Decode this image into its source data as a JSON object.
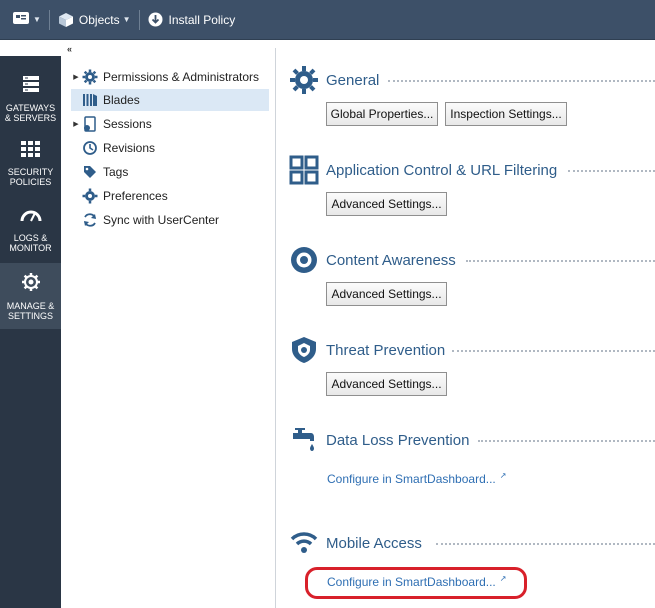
{
  "toolbar": {
    "objects_label": "Objects",
    "install_policy_label": "Install Policy"
  },
  "rail": {
    "items": [
      {
        "label": "GATEWAYS\n& SERVERS",
        "l1": "GATEWAYS",
        "l2": "& SERVERS"
      },
      {
        "label": "SECURITY POLICIES",
        "l1": "SECURITY",
        "l2": "POLICIES"
      },
      {
        "label": "LOGS & MONITOR",
        "l1": "LOGS &",
        "l2": "MONITOR"
      },
      {
        "label": "MANAGE & SETTINGS",
        "l1": "MANAGE &",
        "l2": "SETTINGS"
      }
    ]
  },
  "tree": {
    "items": [
      {
        "label": "Permissions & Administrators"
      },
      {
        "label": "Blades"
      },
      {
        "label": "Sessions"
      },
      {
        "label": "Revisions"
      },
      {
        "label": "Tags"
      },
      {
        "label": "Preferences"
      },
      {
        "label": "Sync with UserCenter"
      }
    ]
  },
  "sections": {
    "general": {
      "title": "General",
      "btn1": "Global Properties...",
      "btn2": "Inspection Settings..."
    },
    "appcontrol": {
      "title": "Application Control & URL Filtering",
      "btn": "Advanced Settings..."
    },
    "content": {
      "title": "Content Awareness",
      "btn": "Advanced Settings..."
    },
    "threat": {
      "title": "Threat Prevention",
      "btn": "Advanced Settings..."
    },
    "dlp": {
      "title": "Data Loss Prevention",
      "link": "Configure in SmartDashboard..."
    },
    "mobile": {
      "title": "Mobile Access",
      "link": "Configure in SmartDashboard..."
    }
  },
  "colors": {
    "toolbar_bg": "#3d5068",
    "rail_bg": "#2a3645",
    "accent_blue": "#2f5d8a",
    "link_blue": "#2f6fb3",
    "highlight_red": "#d8202a"
  }
}
